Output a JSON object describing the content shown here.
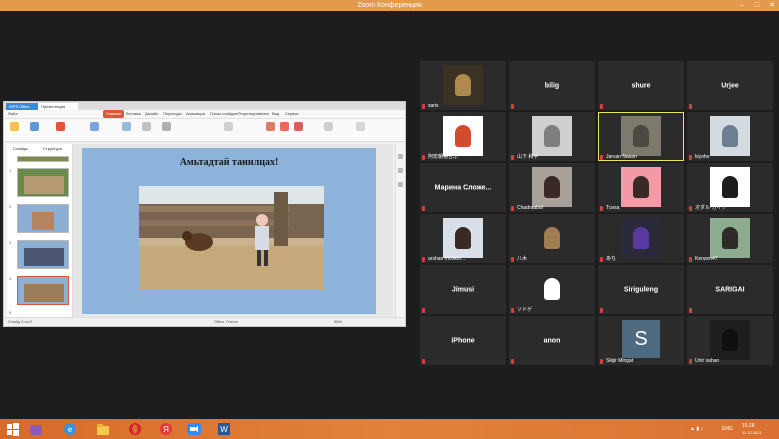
{
  "window": {
    "title": "Zoom Конференция"
  },
  "shared_app": {
    "tabs": [
      "WPS Office",
      "Презентация"
    ],
    "menus": [
      "Файл",
      "Главная",
      "Вставка",
      "Дизайн",
      "Переходы",
      "Анимация",
      "Показ слайдов",
      "Рецензирование",
      "Вид",
      "Сервис"
    ],
    "panel_tabs": [
      "Слайды",
      "Структура"
    ],
    "slide_numbers": [
      "1",
      "2",
      "3",
      "4",
      "5"
    ],
    "slide_title": "Амьтадтай танилцах!",
    "status_left": "Слайд 5 из 5",
    "status_mid": "Office Theme",
    "zoom": "56%"
  },
  "participants": [
    {
      "name": "saris",
      "type": "video"
    },
    {
      "name": "bilig",
      "type": "name"
    },
    {
      "name": "shure",
      "type": "name"
    },
    {
      "name": "Urjee",
      "type": "name"
    },
    {
      "name": "阿宏朝格吉乐",
      "type": "video"
    },
    {
      "name": "山下 和子",
      "type": "video"
    },
    {
      "name": "Jarvan Nasan",
      "type": "video"
    },
    {
      "name": "kiyoho",
      "type": "video"
    },
    {
      "name": "Марина Сложе...",
      "type": "name"
    },
    {
      "name": "Chadraabal",
      "type": "video"
    },
    {
      "name": "Tuvsa",
      "type": "video"
    },
    {
      "name": "オダル·ガイテ",
      "type": "video"
    },
    {
      "name": "arshan monkei...",
      "type": "video"
    },
    {
      "name": "八木",
      "type": "video"
    },
    {
      "name": "あち",
      "type": "video"
    },
    {
      "name": "Kenzen47",
      "type": "video"
    },
    {
      "name": "Jimusi",
      "type": "name"
    },
    {
      "name": "ソドゲ",
      "type": "video"
    },
    {
      "name": "Siriguleng",
      "type": "name"
    },
    {
      "name": "SARIGAI",
      "type": "name"
    },
    {
      "name": "iPhone",
      "type": "name"
    },
    {
      "name": "anon",
      "type": "name"
    },
    {
      "name": "Sikjir Mingat",
      "type": "avatar",
      "initial": "S"
    },
    {
      "name": "Unir sahan",
      "type": "video"
    }
  ],
  "taskbar": {
    "lang": "ENG",
    "time": "16:28",
    "date": "11.12.2021"
  },
  "colors": {
    "accent": "#e39a4c",
    "taskbar": "#dc7533",
    "highlight": "#e9e55a"
  }
}
